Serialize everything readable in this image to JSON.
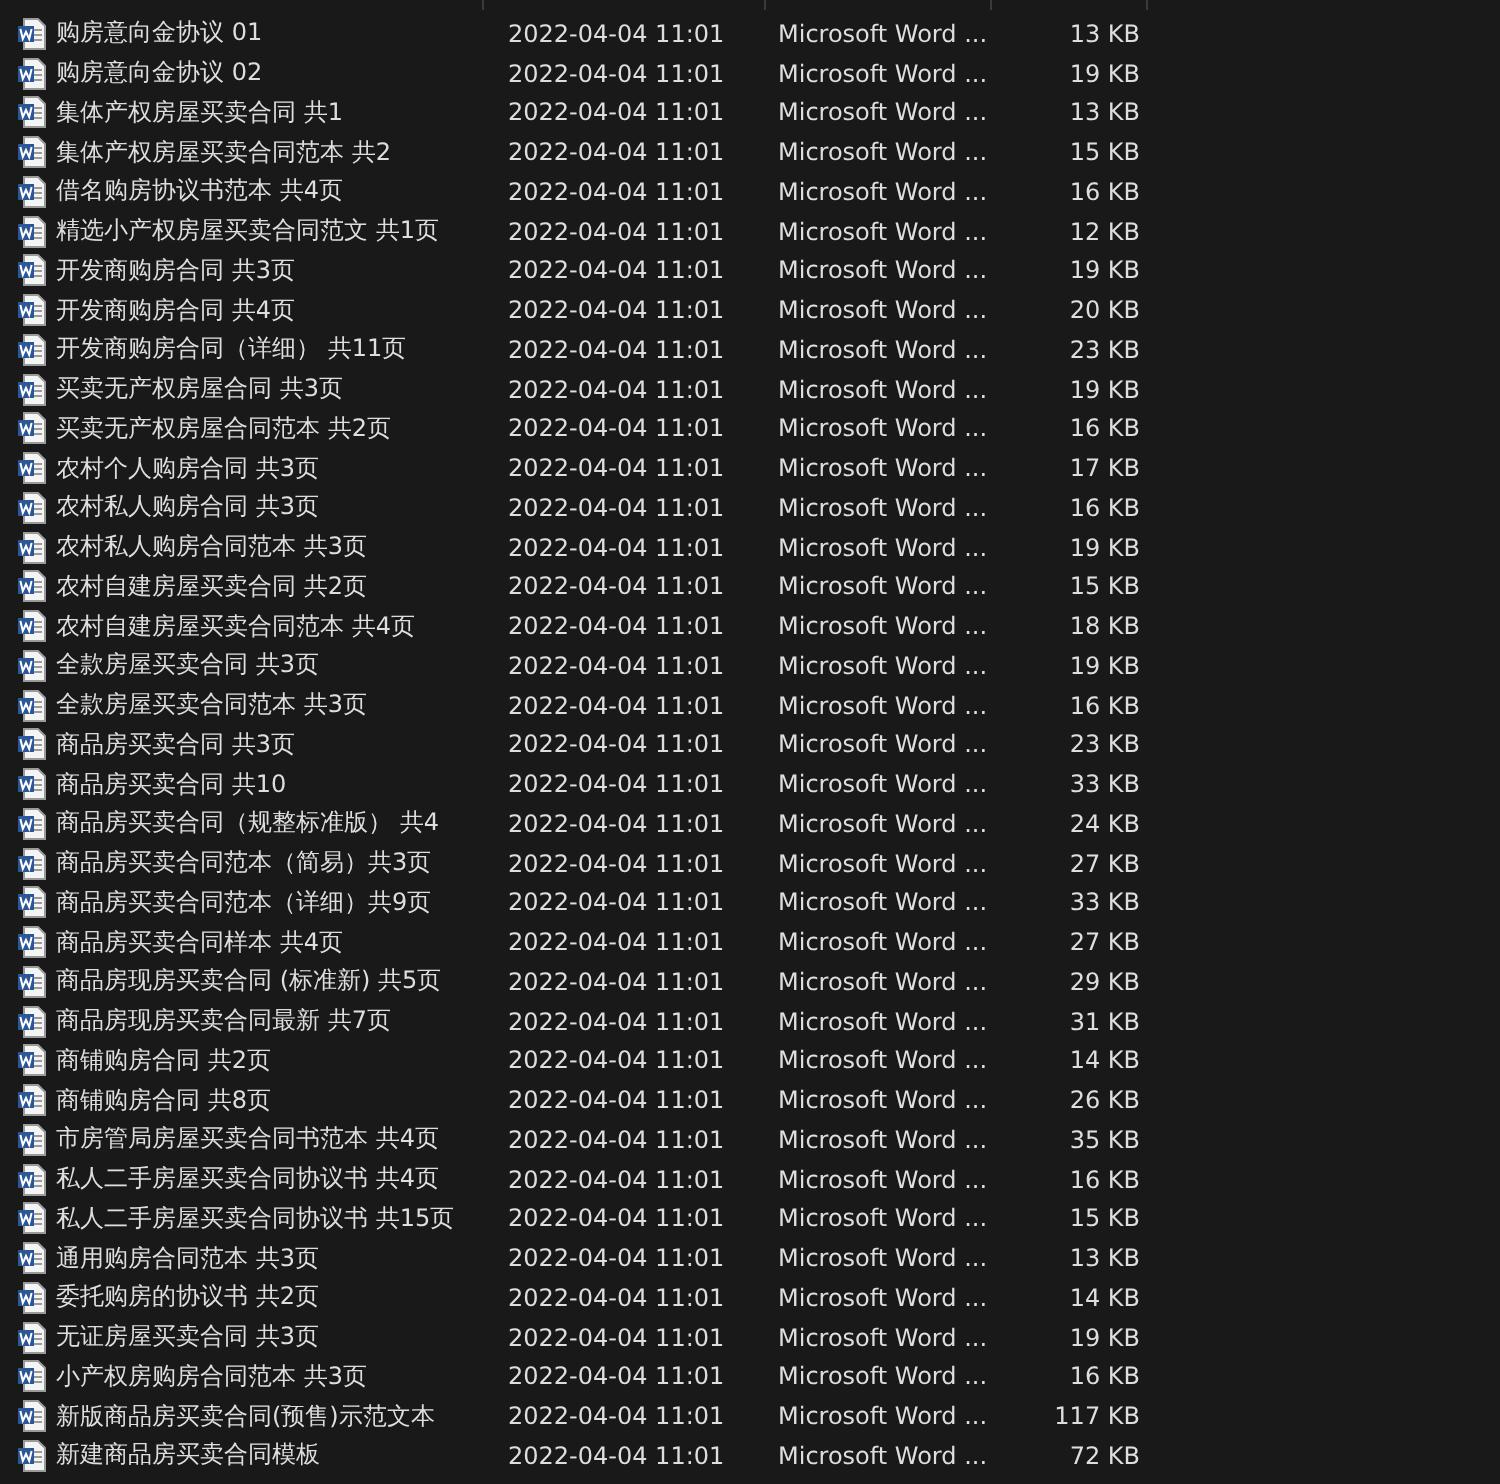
{
  "files": [
    {
      "name": "购房意向金协议 01",
      "modified": "2022-04-04 11:01",
      "type": "Microsoft Word ...",
      "size": "13 KB"
    },
    {
      "name": "购房意向金协议 02",
      "modified": "2022-04-04 11:01",
      "type": "Microsoft Word ...",
      "size": "19 KB"
    },
    {
      "name": "集体产权房屋买卖合同 共1",
      "modified": "2022-04-04 11:01",
      "type": "Microsoft Word ...",
      "size": "13 KB"
    },
    {
      "name": "集体产权房屋买卖合同范本 共2",
      "modified": "2022-04-04 11:01",
      "type": "Microsoft Word ...",
      "size": "15 KB"
    },
    {
      "name": "借名购房协议书范本 共4页",
      "modified": "2022-04-04 11:01",
      "type": "Microsoft Word ...",
      "size": "16 KB"
    },
    {
      "name": "精选小产权房屋买卖合同范文 共1页",
      "modified": "2022-04-04 11:01",
      "type": "Microsoft Word ...",
      "size": "12 KB"
    },
    {
      "name": "开发商购房合同 共3页",
      "modified": "2022-04-04 11:01",
      "type": "Microsoft Word ...",
      "size": "19 KB"
    },
    {
      "name": "开发商购房合同 共4页",
      "modified": "2022-04-04 11:01",
      "type": "Microsoft Word ...",
      "size": "20 KB"
    },
    {
      "name": "开发商购房合同（详细） 共11页",
      "modified": "2022-04-04 11:01",
      "type": "Microsoft Word ...",
      "size": "23 KB"
    },
    {
      "name": "买卖无产权房屋合同 共3页",
      "modified": "2022-04-04 11:01",
      "type": "Microsoft Word ...",
      "size": "19 KB"
    },
    {
      "name": "买卖无产权房屋合同范本 共2页",
      "modified": "2022-04-04 11:01",
      "type": "Microsoft Word ...",
      "size": "16 KB"
    },
    {
      "name": "农村个人购房合同 共3页",
      "modified": "2022-04-04 11:01",
      "type": "Microsoft Word ...",
      "size": "17 KB"
    },
    {
      "name": "农村私人购房合同 共3页",
      "modified": "2022-04-04 11:01",
      "type": "Microsoft Word ...",
      "size": "16 KB"
    },
    {
      "name": "农村私人购房合同范本 共3页",
      "modified": "2022-04-04 11:01",
      "type": "Microsoft Word ...",
      "size": "19 KB"
    },
    {
      "name": "农村自建房屋买卖合同 共2页",
      "modified": "2022-04-04 11:01",
      "type": "Microsoft Word ...",
      "size": "15 KB"
    },
    {
      "name": "农村自建房屋买卖合同范本 共4页",
      "modified": "2022-04-04 11:01",
      "type": "Microsoft Word ...",
      "size": "18 KB"
    },
    {
      "name": "全款房屋买卖合同 共3页",
      "modified": "2022-04-04 11:01",
      "type": "Microsoft Word ...",
      "size": "19 KB"
    },
    {
      "name": "全款房屋买卖合同范本 共3页",
      "modified": "2022-04-04 11:01",
      "type": "Microsoft Word ...",
      "size": "16 KB"
    },
    {
      "name": "商品房买卖合同 共3页",
      "modified": "2022-04-04 11:01",
      "type": "Microsoft Word ...",
      "size": "23 KB"
    },
    {
      "name": "商品房买卖合同 共10",
      "modified": "2022-04-04 11:01",
      "type": "Microsoft Word ...",
      "size": "33 KB"
    },
    {
      "name": "商品房买卖合同（规整标准版） 共4",
      "modified": "2022-04-04 11:01",
      "type": "Microsoft Word ...",
      "size": "24 KB"
    },
    {
      "name": "商品房买卖合同范本（简易）共3页",
      "modified": "2022-04-04 11:01",
      "type": "Microsoft Word ...",
      "size": "27 KB"
    },
    {
      "name": "商品房买卖合同范本（详细）共9页",
      "modified": "2022-04-04 11:01",
      "type": "Microsoft Word ...",
      "size": "33 KB"
    },
    {
      "name": "商品房买卖合同样本 共4页",
      "modified": "2022-04-04 11:01",
      "type": "Microsoft Word ...",
      "size": "27 KB"
    },
    {
      "name": "商品房现房买卖合同 (标准新) 共5页",
      "modified": "2022-04-04 11:01",
      "type": "Microsoft Word ...",
      "size": "29 KB"
    },
    {
      "name": "商品房现房买卖合同最新 共7页",
      "modified": "2022-04-04 11:01",
      "type": "Microsoft Word ...",
      "size": "31 KB"
    },
    {
      "name": "商铺购房合同 共2页",
      "modified": "2022-04-04 11:01",
      "type": "Microsoft Word ...",
      "size": "14 KB"
    },
    {
      "name": "商铺购房合同 共8页",
      "modified": "2022-04-04 11:01",
      "type": "Microsoft Word ...",
      "size": "26 KB"
    },
    {
      "name": "市房管局房屋买卖合同书范本 共4页",
      "modified": "2022-04-04 11:01",
      "type": "Microsoft Word ...",
      "size": "35 KB"
    },
    {
      "name": "私人二手房屋买卖合同协议书 共4页",
      "modified": "2022-04-04 11:01",
      "type": "Microsoft Word ...",
      "size": "16 KB"
    },
    {
      "name": "私人二手房屋买卖合同协议书 共15页",
      "modified": "2022-04-04 11:01",
      "type": "Microsoft Word ...",
      "size": "15 KB"
    },
    {
      "name": "通用购房合同范本 共3页",
      "modified": "2022-04-04 11:01",
      "type": "Microsoft Word ...",
      "size": "13 KB"
    },
    {
      "name": "委托购房的协议书 共2页",
      "modified": "2022-04-04 11:01",
      "type": "Microsoft Word ...",
      "size": "14 KB"
    },
    {
      "name": "无证房屋买卖合同 共3页",
      "modified": "2022-04-04 11:01",
      "type": "Microsoft Word ...",
      "size": "19 KB"
    },
    {
      "name": "小产权房购房合同范本 共3页",
      "modified": "2022-04-04 11:01",
      "type": "Microsoft Word ...",
      "size": "16 KB"
    },
    {
      "name": "新版商品房买卖合同(预售)示范文本",
      "modified": "2022-04-04 11:01",
      "type": "Microsoft Word ...",
      "size": "117 KB"
    },
    {
      "name": "新建商品房买卖合同模板",
      "modified": "2022-04-04 11:01",
      "type": "Microsoft Word ...",
      "size": "72 KB"
    }
  ]
}
